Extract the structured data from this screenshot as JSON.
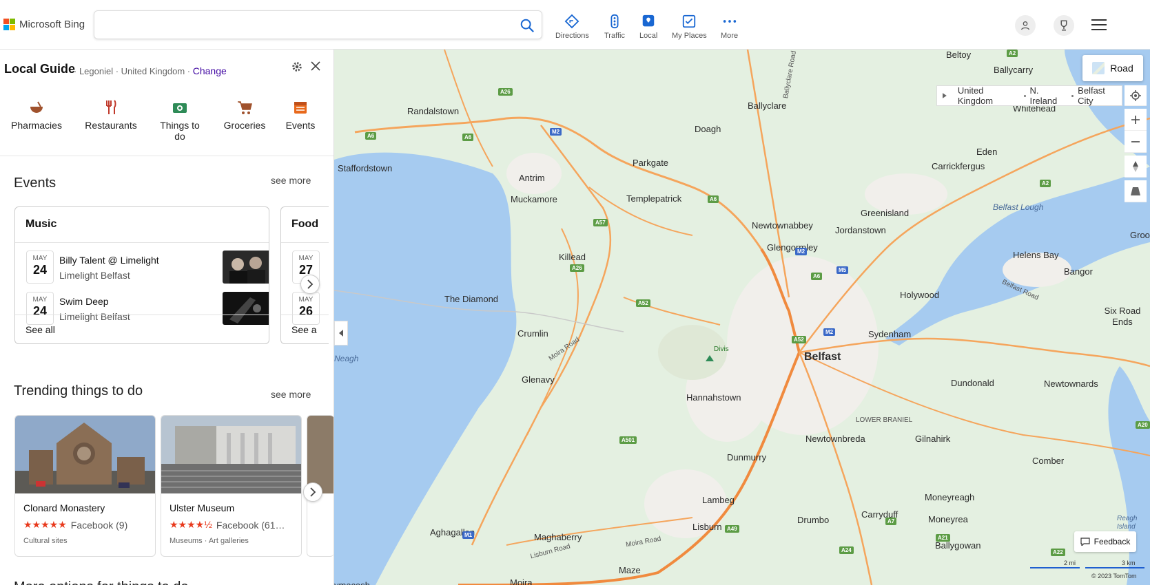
{
  "topbar": {
    "brand": "Microsoft Bing",
    "search": {
      "value": "",
      "placeholder": ""
    },
    "nav": [
      {
        "label": "Directions",
        "icon": "directions-icon"
      },
      {
        "label": "Traffic",
        "icon": "traffic-icon"
      },
      {
        "label": "Local",
        "icon": "local-icon"
      },
      {
        "label": "My Places",
        "icon": "my-places-icon"
      },
      {
        "label": "More",
        "icon": "more-icon"
      }
    ]
  },
  "panel": {
    "title": "Local Guide",
    "location": {
      "area": "Legoniel",
      "country": "United Kingdom",
      "change": "Change"
    },
    "categories": [
      {
        "label": "Pharmacies",
        "icon": "pharmacy-icon"
      },
      {
        "label": "Restaurants",
        "icon": "restaurant-icon"
      },
      {
        "label": "Things to do",
        "icon": "things-to-do-icon"
      },
      {
        "label": "Groceries",
        "icon": "groceries-icon"
      },
      {
        "label": "Events",
        "icon": "events-icon"
      }
    ],
    "events": {
      "title": "Events",
      "see_more": "see more",
      "cards": [
        {
          "heading": "Music",
          "items": [
            {
              "month": "MAY",
              "day": "24",
              "name": "Billy Talent @ Limelight",
              "venue": "Limelight Belfast"
            },
            {
              "month": "MAY",
              "day": "24",
              "name": "Swim Deep",
              "venue": "Limelight Belfast"
            }
          ],
          "see_all": "See all"
        },
        {
          "heading": "Food",
          "items": [
            {
              "month": "MAY",
              "day": "27"
            },
            {
              "month": "MAY",
              "day": "26"
            }
          ],
          "see_all": "See a"
        }
      ]
    },
    "trending": {
      "title": "Trending things to do",
      "see_more": "see more",
      "items": [
        {
          "name": "Clonard Monastery",
          "rating": 5,
          "source": "Facebook (9)",
          "tags": "Cultural sites"
        },
        {
          "name": "Ulster Museum",
          "rating": 4.5,
          "source": "Facebook (61…",
          "tags": "Museums · Art galleries"
        }
      ]
    },
    "next_section_partial": "More options for things to do"
  },
  "map": {
    "style_button": "Road",
    "breadcrumb": [
      "United Kingdom",
      "N. Ireland",
      "Belfast City"
    ],
    "feedback": "Feedback",
    "scale": {
      "miles": "2 mi",
      "km": "3 km"
    },
    "copyright": "© 2023 TomTom",
    "colors": {
      "land": "#e4f0e1",
      "water": "#a6cbf0",
      "road": "#f5a55c",
      "motorway_shield": "#3b69c7",
      "a_road_shield": "#5c9c45"
    },
    "places": [
      {
        "name": "Belfast",
        "type": "city"
      },
      {
        "name": "Beltoy"
      },
      {
        "name": "Ballycarry"
      },
      {
        "name": "Whitehead"
      },
      {
        "name": "Randalstown"
      },
      {
        "name": "Ballyclare"
      },
      {
        "name": "Doagh"
      },
      {
        "name": "Staffordstown"
      },
      {
        "name": "Parkgate"
      },
      {
        "name": "Eden"
      },
      {
        "name": "Carrickfergus"
      },
      {
        "name": "Antrim"
      },
      {
        "name": "Muckamore"
      },
      {
        "name": "Templepatrick"
      },
      {
        "name": "Greenisland"
      },
      {
        "name": "Newtownabbey"
      },
      {
        "name": "Jordanstown"
      },
      {
        "name": "Glengormley"
      },
      {
        "name": "Groomsp"
      },
      {
        "name": "Helens Bay"
      },
      {
        "name": "Killead"
      },
      {
        "name": "Bangor"
      },
      {
        "name": "The Diamond"
      },
      {
        "name": "Holywood"
      },
      {
        "name": "Six Road Ends"
      },
      {
        "name": "Crumlin"
      },
      {
        "name": "Sydenham"
      },
      {
        "name": "Divis"
      },
      {
        "name": "Glenavy"
      },
      {
        "name": "Hannahstown"
      },
      {
        "name": "Dundonald"
      },
      {
        "name": "Newtownards"
      },
      {
        "name": "Newtownbreda"
      },
      {
        "name": "Gilnahirk"
      },
      {
        "name": "Dunmurry"
      },
      {
        "name": "Comber"
      },
      {
        "name": "Moneyreagh"
      },
      {
        "name": "Lambeg"
      },
      {
        "name": "Drumbo"
      },
      {
        "name": "Carryduff"
      },
      {
        "name": "Moneyrea"
      },
      {
        "name": "Aghagallon"
      },
      {
        "name": "Lisburn"
      },
      {
        "name": "Maghaberry"
      },
      {
        "name": "Ballygowan"
      },
      {
        "name": "Maze"
      },
      {
        "name": "Moira"
      },
      {
        "name": "ymacash"
      },
      {
        "name": "LOWER BRANIEL"
      }
    ],
    "water_labels": [
      "Belfast Lough",
      "Neagh",
      "Reagh Island"
    ],
    "road_labels": [
      "Ballyclare Road",
      "Moira Road",
      "Belfast Road",
      "Lisburn Road"
    ],
    "shields": [
      "A2",
      "A26",
      "A6",
      "M2",
      "A57",
      "A52",
      "M5",
      "A501",
      "M1",
      "A7",
      "A49",
      "A24",
      "A21",
      "A22",
      "A20"
    ]
  }
}
